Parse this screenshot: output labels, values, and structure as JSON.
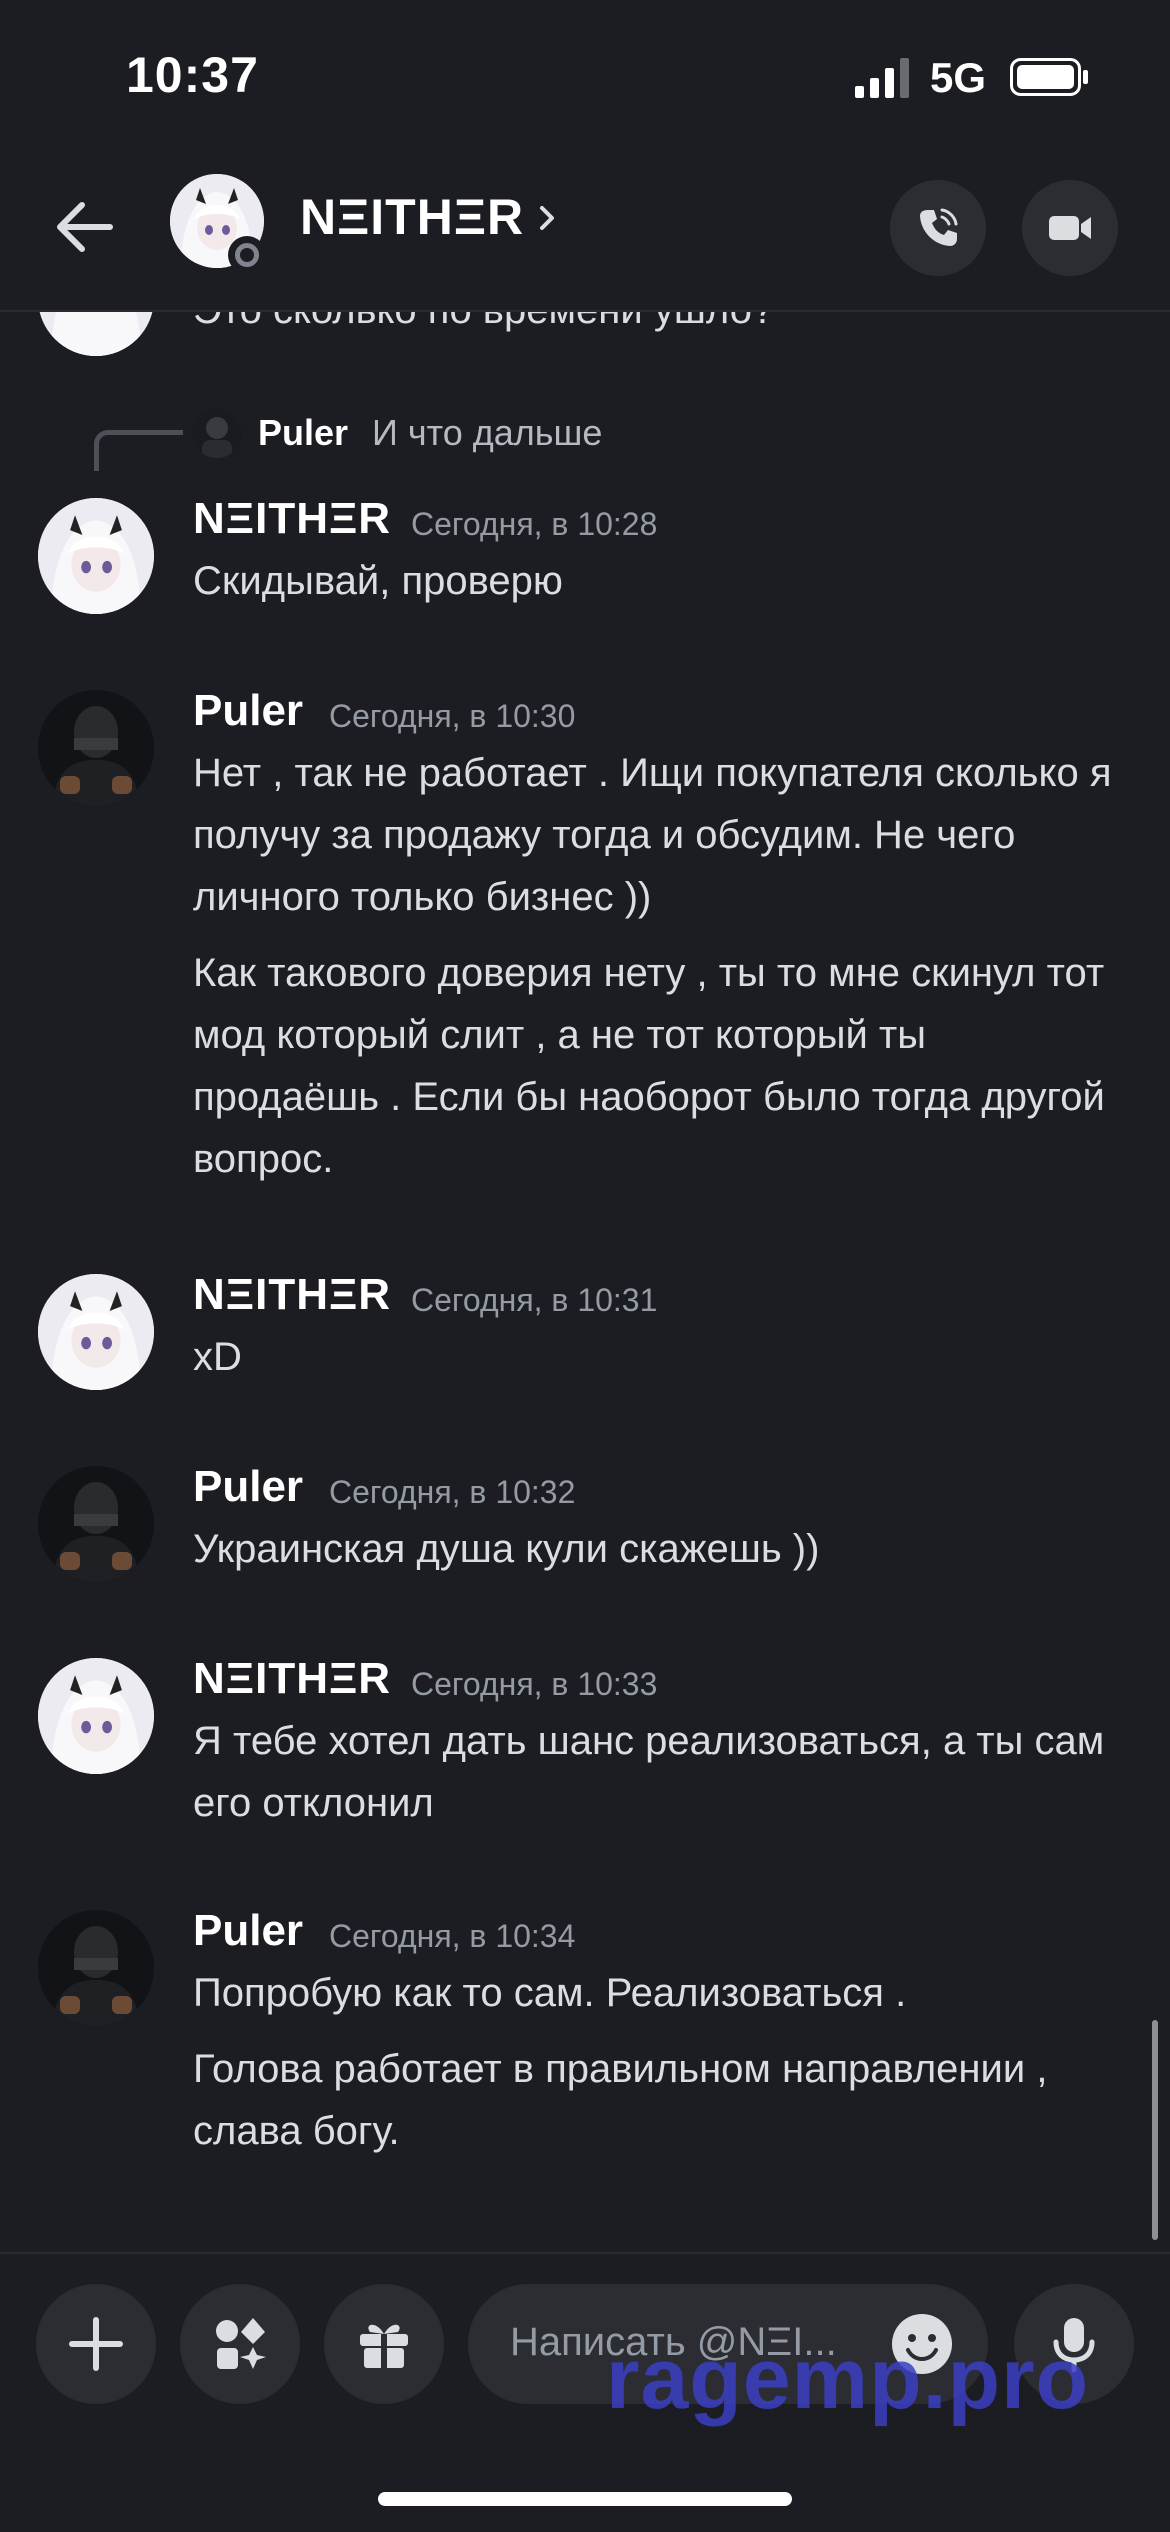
{
  "status_bar": {
    "time": "10:37",
    "network": "5G"
  },
  "header": {
    "name": "NΞITHΞR"
  },
  "messages": {
    "partial_text": "Это сколько по времени ушло?",
    "reply": {
      "name": "Puler",
      "text": "И что дальше"
    },
    "m1": {
      "author": "NΞITHΞR",
      "timestamp": "Сегодня, в 10:28",
      "line1": "Скидывай, проверю"
    },
    "m2": {
      "author": "Puler",
      "timestamp": "Сегодня, в 10:30",
      "p1": "Нет , так не работает . Ищи покупателя сколько я получу за продажу тогда и обсудим. Не чего личного только бизнес ))",
      "p2": "Как такового доверия нету , ты то мне скинул тот мод который слит , а не тот который ты продаёшь . Если бы наоборот было тогда другой вопрос."
    },
    "m3": {
      "author": "NΞITHΞR",
      "timestamp": "Сегодня, в 10:31",
      "line1": "xD"
    },
    "m4": {
      "author": "Puler",
      "timestamp": "Сегодня, в 10:32",
      "line1": "Украинская душа кули скажешь ))"
    },
    "m5": {
      "author": "NΞITHΞR",
      "timestamp": "Сегодня, в 10:33",
      "line1": "Я тебе хотел дать шанс реализоваться, а ты сам его отклонил"
    },
    "m6": {
      "author": "Puler",
      "timestamp": "Сегодня, в 10:34",
      "p1": "Попробую как то сам. Реализоваться .",
      "p2": "Голова работает в правильном направлении , слава богу."
    }
  },
  "composer": {
    "placeholder": "Написать @NΞI..."
  },
  "watermark": "ragemp.pro",
  "colors": {
    "background": "#1c1d22",
    "button": "#2b2d33",
    "muted": "#949ba4",
    "watermark": "#3b3fc2"
  }
}
